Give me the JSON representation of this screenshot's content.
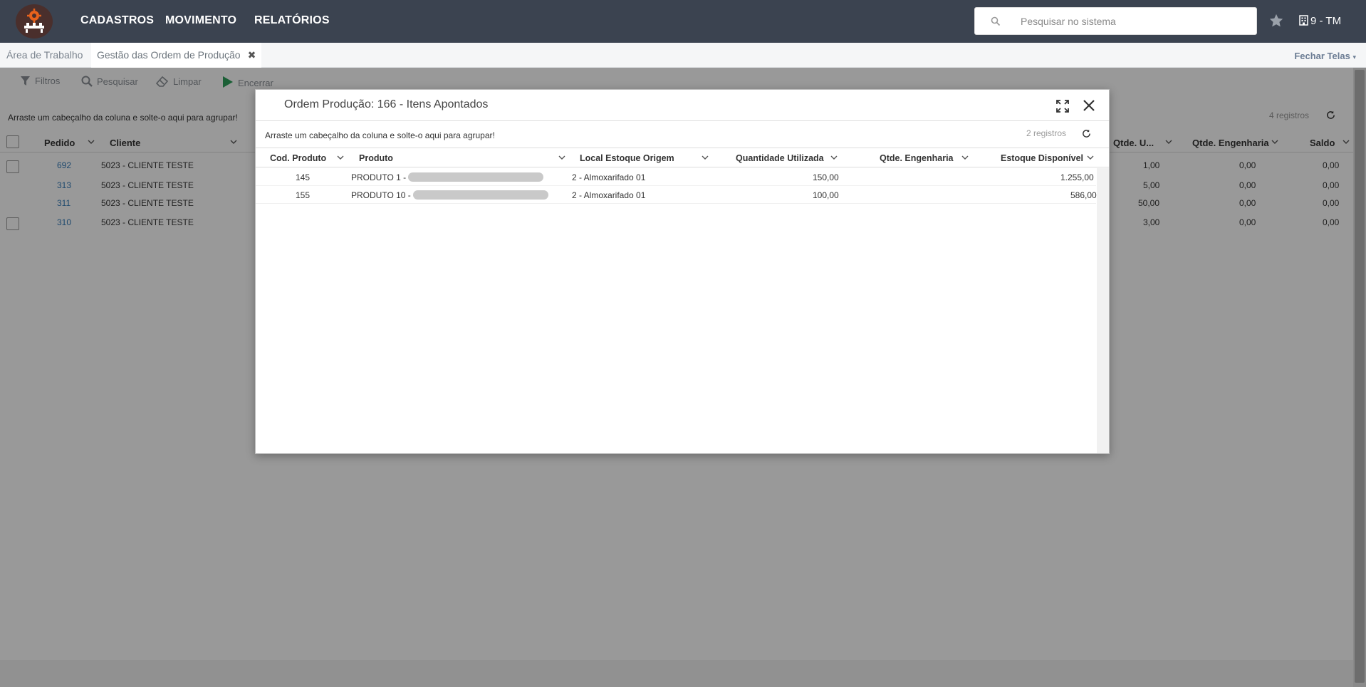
{
  "navbar": {
    "menu": [
      "CADASTROS",
      "MOVIMENTO",
      "RELATÓRIOS"
    ],
    "search_placeholder": "Pesquisar no sistema",
    "company": "9 - TM"
  },
  "tabs": {
    "workspace": "Área de Trabalho",
    "active": "Gestão das Ordem de Produção",
    "close_all": "Fechar Telas"
  },
  "toolbar": {
    "filters": "Filtros",
    "search": "Pesquisar",
    "clear": "Limpar",
    "close_order": "Encerrar"
  },
  "background_grid": {
    "group_hint": "Arraste um cabeçalho da coluna e solte-o aqui para agrupar!",
    "count": "4 registros",
    "columns": {
      "pedido": "Pedido",
      "cliente": "Cliente",
      "qtde_u": "Qtde. U...",
      "qtde_eng": "Qtde. Engenharia",
      "saldo": "Saldo"
    },
    "rows": [
      {
        "pedido": "692",
        "cliente": "5023 - CLIENTE TESTE",
        "qtde_u": "1,00",
        "qtde_eng": "0,00",
        "saldo": "0,00"
      },
      {
        "pedido": "313",
        "cliente": "5023 - CLIENTE TESTE",
        "qtde_u": "5,00",
        "qtde_eng": "0,00",
        "saldo": "0,00"
      },
      {
        "pedido": "311",
        "cliente": "5023 - CLIENTE TESTE",
        "qtde_u": "50,00",
        "qtde_eng": "0,00",
        "saldo": "0,00"
      },
      {
        "pedido": "310",
        "cliente": "5023 - CLIENTE TESTE",
        "qtde_u": "3,00",
        "qtde_eng": "0,00",
        "saldo": "0,00"
      }
    ]
  },
  "modal": {
    "title": "Ordem Produção: 166 - Itens Apontados",
    "group_hint": "Arraste um cabeçalho da coluna e solte-o aqui para agrupar!",
    "count": "2 registros",
    "columns": {
      "cod": "Cod. Produto",
      "produto": "Produto",
      "local": "Local Estoque Origem",
      "qtd_util": "Quantidade Utilizada",
      "qtde_eng": "Qtde. Engenharia",
      "estoque": "Estoque Disponível"
    },
    "rows": [
      {
        "cod": "145",
        "produto": "PRODUTO 1 - ",
        "local": "2 - Almoxarifado 01",
        "qtd_util": "150,00",
        "qtde_eng": "",
        "estoque": "1.255,00"
      },
      {
        "cod": "155",
        "produto": "PRODUTO 10 - ",
        "local": "2 - Almoxarifado 01",
        "qtd_util": "100,00",
        "qtde_eng": "",
        "estoque": "586,00"
      }
    ]
  },
  "colors": {
    "navbar": "#3b4350",
    "link": "#337ab7",
    "overlay": "rgba(0,0,0,0.40)"
  }
}
